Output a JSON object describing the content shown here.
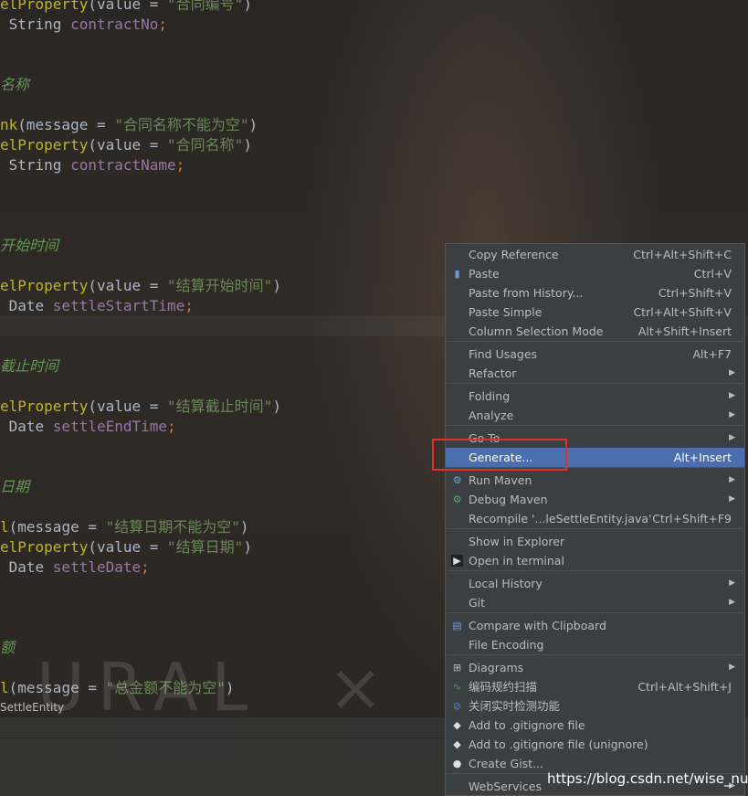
{
  "code": {
    "lines": [
      {
        "anno": "elProperty",
        "p1": "(value = ",
        "str": "\"合同编号\"",
        "p2": ")"
      },
      {
        "type": "String",
        "field": "contractNo"
      },
      {
        "comment": "名称"
      },
      {
        "anno": "nk",
        "p1": "(message = ",
        "str": "\"合同名称不能为空\"",
        "p2": ")"
      },
      {
        "anno": "elProperty",
        "p1": "(value = ",
        "str": "\"合同名称\"",
        "p2": ")"
      },
      {
        "type": "String",
        "field": "contractName"
      },
      {
        "comment": "开始时间"
      },
      {
        "anno": "elProperty",
        "p1": "(value = ",
        "str": "\"结算开始时间\"",
        "p2": ")"
      },
      {
        "type": "Date",
        "field": "settleStartTime"
      },
      {
        "comment": "截止时间"
      },
      {
        "anno": "elProperty",
        "p1": "(value = ",
        "str": "\"结算截止时间\"",
        "p2": ")"
      },
      {
        "type": "Date",
        "field": "settleEndTime"
      },
      {
        "comment": "日期"
      },
      {
        "anno": "l",
        "p1": "(message = ",
        "str": "\"结算日期不能为空\"",
        "p2": ")"
      },
      {
        "anno": "elProperty",
        "p1": "(value = ",
        "str": "\"结算日期\"",
        "p2": ")"
      },
      {
        "type": "Date",
        "field": "settleDate"
      },
      {
        "comment": "额"
      },
      {
        "anno": "l",
        "p1": "(message = ",
        "str": "\"总金额不能为空\"",
        "p2": ")"
      }
    ],
    "semicolon": ";"
  },
  "watermark": "URAL  ×  L",
  "breadcrumb": "SettleEntity",
  "context_menu": {
    "items": [
      {
        "label": "Copy Reference",
        "shortcut": "Ctrl+Alt+Shift+C"
      },
      {
        "label": "Paste",
        "shortcut": "Ctrl+V",
        "icon": "clipboard-icon"
      },
      {
        "label": "Paste from History...",
        "shortcut": "Ctrl+Shift+V"
      },
      {
        "label": "Paste Simple",
        "shortcut": "Ctrl+Alt+Shift+V"
      },
      {
        "label": "Column Selection Mode",
        "shortcut": "Alt+Shift+Insert"
      },
      {
        "label": "Find Usages",
        "shortcut": "Alt+F7"
      },
      {
        "label": "Refactor",
        "submenu": true
      },
      {
        "label": "Folding",
        "submenu": true
      },
      {
        "label": "Analyze",
        "submenu": true
      },
      {
        "label": "Go To",
        "submenu": true
      },
      {
        "label": "Generate...",
        "shortcut": "Alt+Insert",
        "selected": true
      },
      {
        "label": "Run Maven",
        "submenu": true,
        "icon": "maven-gear-icon"
      },
      {
        "label": "Debug Maven",
        "submenu": true,
        "icon": "maven-debug-icon"
      },
      {
        "label": "Recompile '...leSettleEntity.java'",
        "shortcut": "Ctrl+Shift+F9"
      },
      {
        "label": "Show in Explorer"
      },
      {
        "label": "Open in terminal",
        "icon": "terminal-icon"
      },
      {
        "label": "Local History",
        "submenu": true
      },
      {
        "label": "Git",
        "submenu": true
      },
      {
        "label": "Compare with Clipboard",
        "icon": "compare-icon"
      },
      {
        "label": "File Encoding"
      },
      {
        "label": "Diagrams",
        "submenu": true,
        "icon": "diagram-icon"
      },
      {
        "label": "编码规约扫描",
        "shortcut": "Ctrl+Alt+Shift+J",
        "icon": "scan-icon"
      },
      {
        "label": "关闭实时检测功能",
        "icon": "block-icon"
      },
      {
        "label": "Add to .gitignore file",
        "icon": "gitignore-icon"
      },
      {
        "label": "Add to .gitignore file (unignore)",
        "icon": "gitignore-icon"
      },
      {
        "label": "Create Gist...",
        "icon": "github-icon"
      },
      {
        "label": "WebServices",
        "submenu": true
      }
    ]
  },
  "site_watermark": "https://blog.csdn.net/wise_nut",
  "colors": {
    "selection": "#4b6eaf",
    "menu_bg": "#3c3f41",
    "highlight_box": "#e0302a"
  }
}
